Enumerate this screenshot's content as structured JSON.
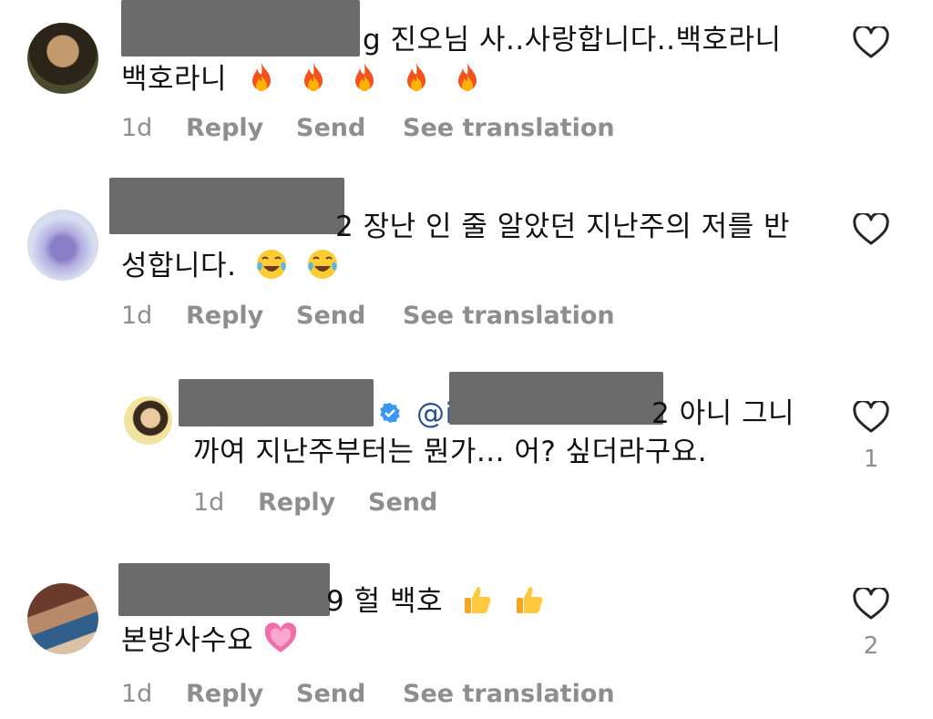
{
  "comments": [
    {
      "line1": "g 진오님 사..사랑합니다..백호라니",
      "line2": "백호라니",
      "emoji": "fire",
      "emoji_count": 5,
      "age": "1d",
      "reply": "Reply",
      "send": "Send",
      "translate": "See translation"
    },
    {
      "line1": "2 장난 인 줄 알았던 지난주의 저를 반",
      "line2": "성합니다.",
      "emoji": "tears-of-joy",
      "emoji_count": 2,
      "age": "1d",
      "reply": "Reply",
      "send": "Send",
      "translate": "See translation"
    },
    {
      "mention": "@i",
      "line1_tail": "2 아니 그니",
      "line2": "까여 지난주부터는 뭔가... 어? 싶더라구요.",
      "age": "1d",
      "reply": "Reply",
      "send": "Send",
      "likes": "1"
    },
    {
      "line1": "9 헐 백호",
      "line2": "본방사수요",
      "emoji": "thumbs-up",
      "emoji_count": 2,
      "emoji2": "growing-heart",
      "age": "1d",
      "reply": "Reply",
      "send": "Send",
      "translate": "See translation",
      "likes": "2"
    }
  ],
  "icons": {
    "like": "heart-outline-icon",
    "verified": "verified-badge-icon"
  },
  "colors": {
    "meta": "#8e8e8e",
    "mention": "#2b4f8c",
    "verified": "#3897f0",
    "redaction": "#6b6b6b"
  }
}
